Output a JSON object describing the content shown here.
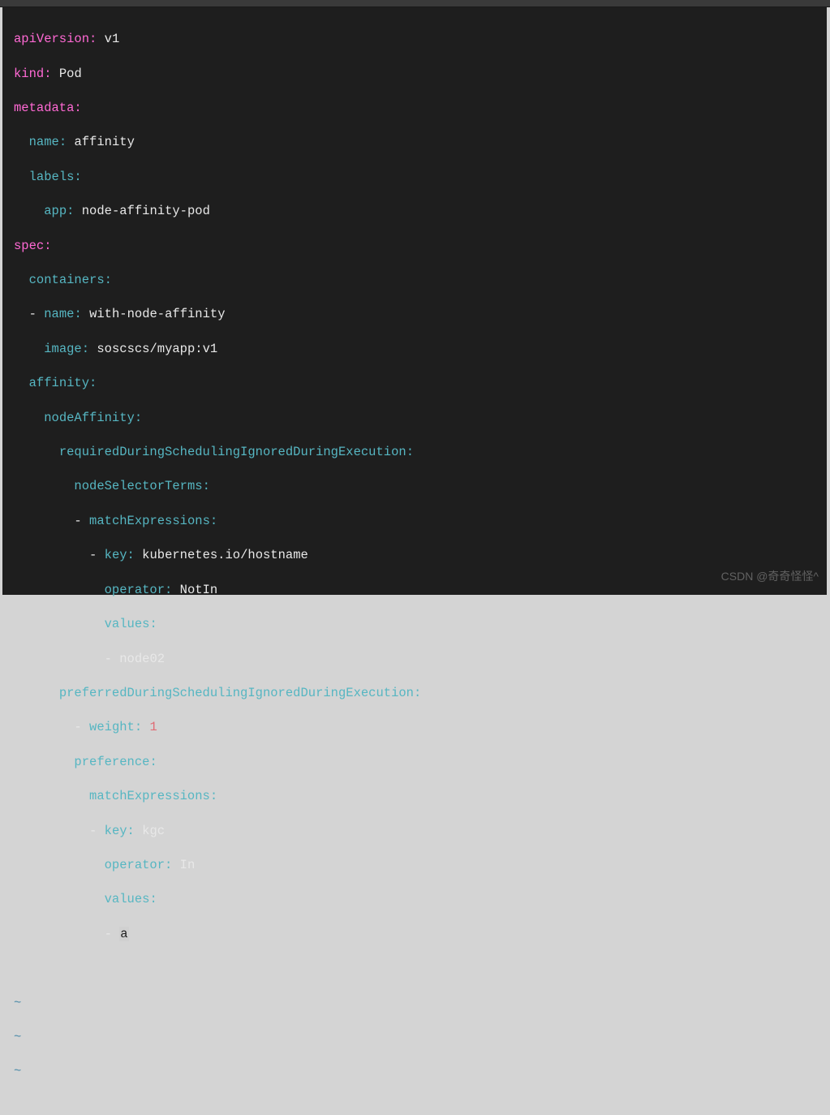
{
  "yaml": {
    "apiVersion": {
      "key": "apiVersion",
      "value": "v1"
    },
    "kind": {
      "key": "kind",
      "value": "Pod"
    },
    "metadata": {
      "key": "metadata",
      "name": {
        "key": "name",
        "value": "affinity"
      },
      "labels": {
        "key": "labels",
        "app": {
          "key": "app",
          "value": "node-affinity-pod"
        }
      }
    },
    "spec": {
      "key": "spec",
      "containers": {
        "key": "containers",
        "item": {
          "name": {
            "key": "name",
            "value": "with-node-affinity"
          },
          "image": {
            "key": "image",
            "value": "soscscs/myapp:v1"
          }
        }
      },
      "affinity": {
        "key": "affinity",
        "nodeAffinity": {
          "key": "nodeAffinity",
          "required": {
            "key": "requiredDuringSchedulingIgnoredDuringExecution",
            "nodeSelectorTerms": {
              "key": "nodeSelectorTerms",
              "matchExpressions": {
                "key": "matchExpressions",
                "item": {
                  "keyField": {
                    "key": "key",
                    "value": "kubernetes.io/hostname"
                  },
                  "operator": {
                    "key": "operator",
                    "value": "NotIn"
                  },
                  "values": {
                    "key": "values",
                    "item": "node02"
                  }
                }
              }
            }
          },
          "preferred": {
            "key": "preferredDuringSchedulingIgnoredDuringExecution",
            "weight": {
              "key": "weight",
              "value": "1"
            },
            "preference": {
              "key": "preference",
              "matchExpressions": {
                "key": "matchExpressions",
                "item": {
                  "keyField": {
                    "key": "key",
                    "value": "kgc"
                  },
                  "operator": {
                    "key": "operator",
                    "value": "In"
                  },
                  "values": {
                    "key": "values",
                    "item": "a"
                  }
                }
              }
            }
          }
        }
      }
    }
  },
  "tilde": "~",
  "watermark": "CSDN @奇奇怪怪^"
}
